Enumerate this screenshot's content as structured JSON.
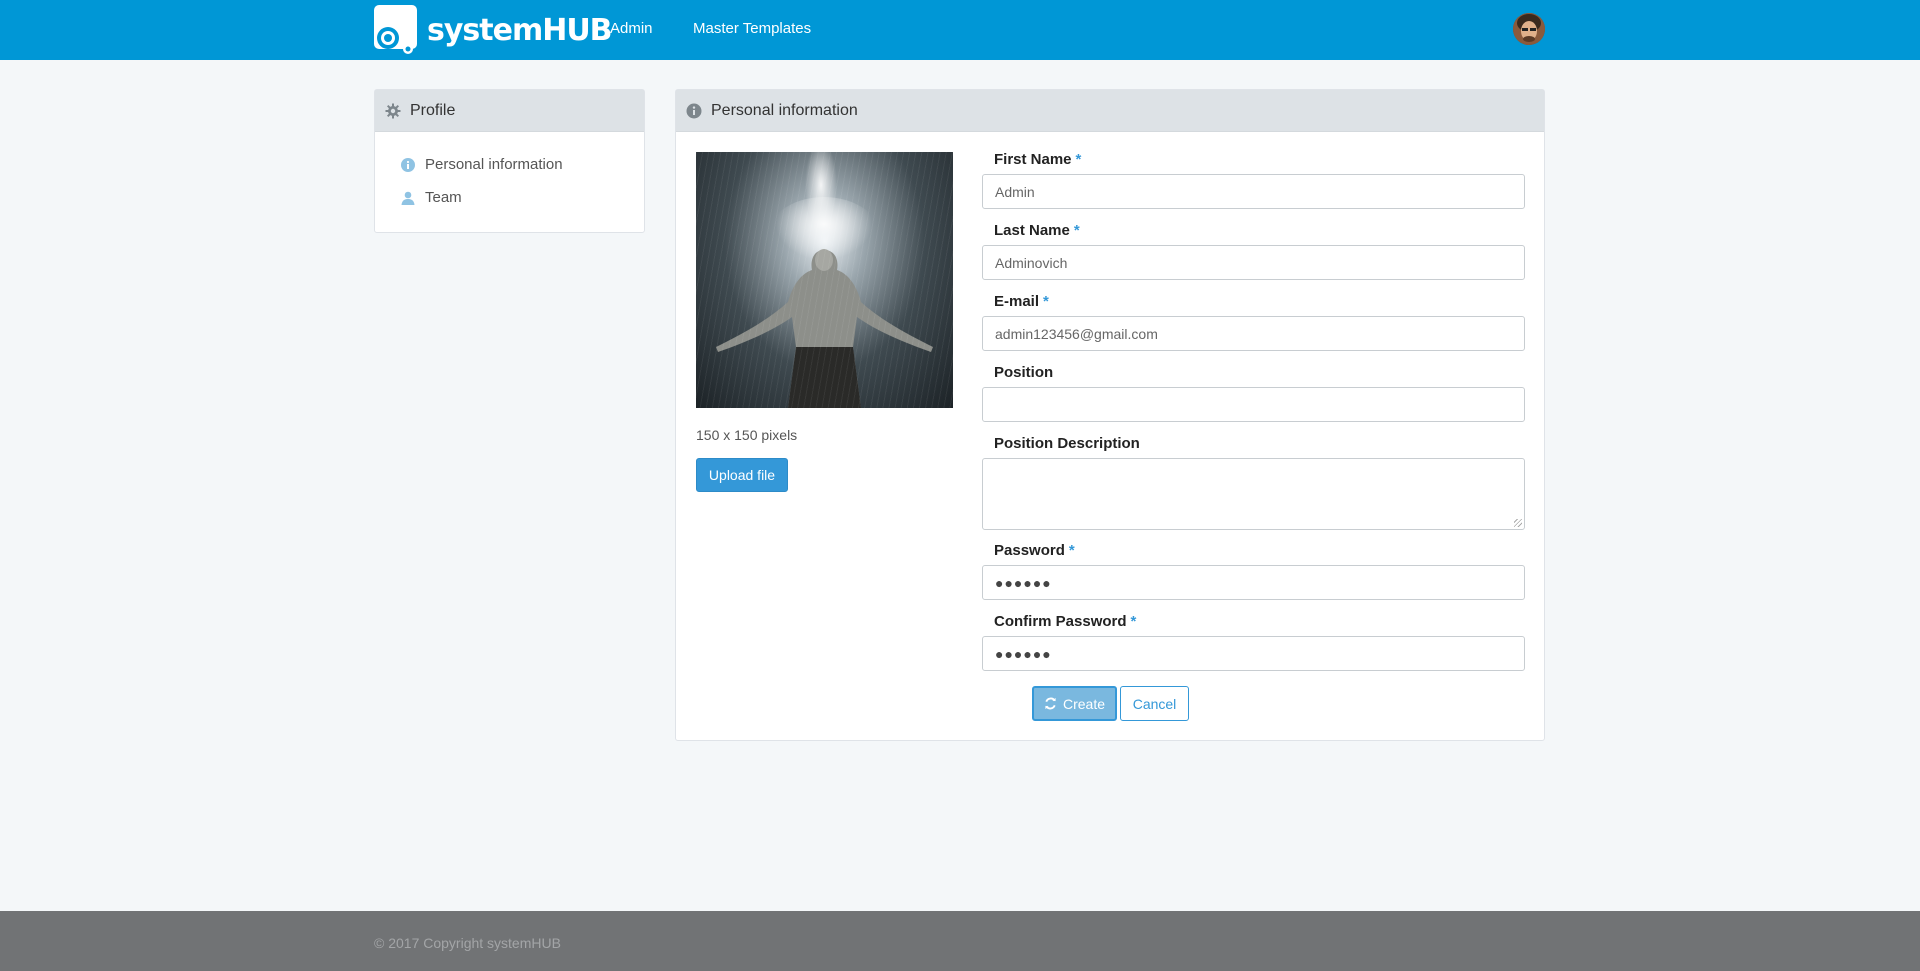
{
  "navbar": {
    "brand": "systemHUB",
    "links": [
      "Admin",
      "Master Templates"
    ]
  },
  "sidebar": {
    "title": "Profile",
    "items": [
      {
        "label": "Personal information",
        "icon": "info-circle-icon"
      },
      {
        "label": "Team",
        "icon": "user-icon"
      }
    ]
  },
  "main": {
    "title": "Personal information",
    "photo_size": "150 x 150 pixels",
    "upload_label": "Upload file",
    "fields": {
      "first_name": {
        "label": "First Name",
        "required": "*",
        "value": "Admin"
      },
      "last_name": {
        "label": "Last Name",
        "required": "*",
        "value": "Adminovich"
      },
      "email": {
        "label": "E-mail",
        "required": "*",
        "value": "admin123456@gmail.com"
      },
      "position": {
        "label": "Position",
        "value": ""
      },
      "position_description": {
        "label": "Position Description",
        "value": ""
      },
      "password": {
        "label": "Password",
        "required": "*",
        "value": "●●●●●●"
      },
      "confirm_password": {
        "label": "Confirm Password",
        "required": "*",
        "value": "●●●●●●"
      }
    },
    "create_label": "Create",
    "cancel_label": "Cancel"
  },
  "footer": {
    "text": "© 2017 Copyright systemHUB"
  },
  "colors": {
    "navbar": "#0097d6",
    "accent": "#3498d8",
    "footer": "#717375"
  }
}
